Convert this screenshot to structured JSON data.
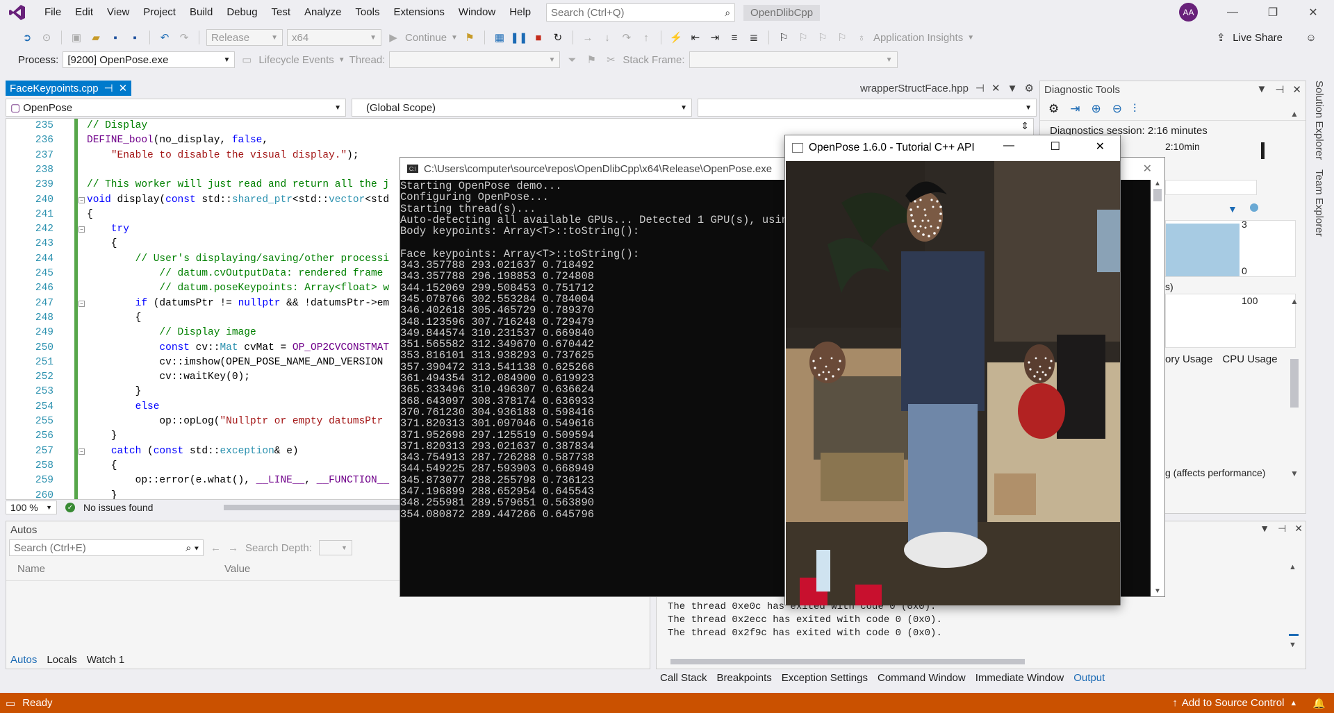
{
  "menubar": {
    "items": [
      "File",
      "Edit",
      "View",
      "Project",
      "Build",
      "Debug",
      "Test",
      "Analyze",
      "Tools",
      "Extensions",
      "Window",
      "Help"
    ],
    "search_placeholder": "Search (Ctrl+Q)",
    "project_name": "OpenDlibCpp",
    "user_initials": "AA"
  },
  "toolbar": {
    "config": "Release",
    "platform": "x64",
    "continue_label": "Continue",
    "app_insights": "Application Insights",
    "live_share": "Live Share"
  },
  "debug_location": {
    "process_label": "Process:",
    "process_value": "[9200] OpenPose.exe",
    "lifecycle_label": "Lifecycle Events",
    "thread_label": "Thread:",
    "stack_frame_label": "Stack Frame:"
  },
  "tabs": {
    "active": "FaceKeypoints.cpp",
    "other": "wrapperStructFace.hpp"
  },
  "navbar": {
    "project": "OpenPose",
    "scope": "(Global Scope)"
  },
  "editor": {
    "lines": [
      {
        "num": "235",
        "text": "// Display"
      },
      {
        "num": "236",
        "text": "DEFINE_bool(no_display, false,"
      },
      {
        "num": "237",
        "text": "    \"Enable to disable the visual display.\");"
      },
      {
        "num": "238",
        "text": ""
      },
      {
        "num": "239",
        "text": "// This worker will just read and return all the j"
      },
      {
        "num": "240",
        "text": "void display(const std::shared_ptr<std::vector<std"
      },
      {
        "num": "241",
        "text": "{"
      },
      {
        "num": "242",
        "text": "    try"
      },
      {
        "num": "243",
        "text": "    {"
      },
      {
        "num": "244",
        "text": "        // User's displaying/saving/other processi"
      },
      {
        "num": "245",
        "text": "            // datum.cvOutputData: rendered frame"
      },
      {
        "num": "246",
        "text": "            // datum.poseKeypoints: Array<float> w"
      },
      {
        "num": "247",
        "text": "        if (datumsPtr != nullptr && !datumsPtr->em"
      },
      {
        "num": "248",
        "text": "        {"
      },
      {
        "num": "249",
        "text": "            // Display image"
      },
      {
        "num": "250",
        "text": "            const cv::Mat cvMat = OP_OP2CVCONSTMAT"
      },
      {
        "num": "251",
        "text": "            cv::imshow(OPEN_POSE_NAME_AND_VERSION"
      },
      {
        "num": "252",
        "text": "            cv::waitKey(0);"
      },
      {
        "num": "253",
        "text": "        }"
      },
      {
        "num": "254",
        "text": "        else"
      },
      {
        "num": "255",
        "text": "            op::opLog(\"Nullptr or empty datumsPtr"
      },
      {
        "num": "256",
        "text": "    }"
      },
      {
        "num": "257",
        "text": "    catch (const std::exception& e)"
      },
      {
        "num": "258",
        "text": "    {"
      },
      {
        "num": "259",
        "text": "        op::error(e.what(), __LINE__, __FUNCTION__"
      },
      {
        "num": "260",
        "text": "    }"
      }
    ],
    "zoom": "100 %",
    "issues": "No issues found"
  },
  "diagnostics": {
    "title": "Diagnostic Tools",
    "session": "Diagnostics session: 2:16 minutes",
    "time_mark": "2:10min",
    "y_top": "3",
    "y_bottom": "0",
    "y_mem": "100",
    "s_label": "s)",
    "tab_memory": "ory Usage",
    "tab_cpu": "CPU Usage",
    "profiling_note": "g (affects performance)"
  },
  "side_tabs": [
    "Solution Explorer",
    "Team Explorer"
  ],
  "autos": {
    "title": "Autos",
    "search_placeholder": "Search (Ctrl+E)",
    "search_depth": "Search Depth:",
    "col_name": "Name",
    "col_value": "Value",
    "tabs": [
      "Autos",
      "Locals",
      "Watch 1"
    ]
  },
  "output": {
    "lines": [
      "The thread 0xe0c has exited with code 0 (0x0).",
      "The thread 0x2ecc has exited with code 0 (0x0).",
      "The thread 0x2f9c has exited with code 0 (0x0)."
    ],
    "tabs": [
      "Call Stack",
      "Breakpoints",
      "Exception Settings",
      "Command Window",
      "Immediate Window",
      "Output"
    ]
  },
  "statusbar": {
    "ready": "Ready",
    "source_control": "Add to Source Control"
  },
  "console": {
    "title": "C:\\Users\\computer\\source\\repos\\OpenDlibCpp\\x64\\Release\\OpenPose.exe",
    "lines": [
      "Starting OpenPose demo...",
      "Configuring OpenPose...",
      "Starting thread(s)...",
      "Auto-detecting all available GPUs... Detected 1 GPU(s), using",
      "Body keypoints: Array<T>::toString():",
      "",
      "Face keypoints: Array<T>::toString():",
      "343.357788 293.021637 0.718492",
      "343.357788 296.198853 0.724808",
      "344.152069 299.508453 0.751712",
      "345.078766 302.553284 0.784004",
      "346.402618 305.465729 0.789370",
      "348.123596 307.716248 0.729479",
      "349.844574 310.231537 0.669840",
      "351.565582 312.349670 0.670442",
      "353.816101 313.938293 0.737625",
      "357.390472 313.541138 0.625266",
      "361.494354 312.084900 0.619923",
      "365.333496 310.496307 0.636624",
      "368.643097 308.378174 0.636933",
      "370.761230 304.936188 0.598416",
      "371.820313 301.097046 0.549616",
      "371.952698 297.125519 0.509594",
      "371.820313 293.021637 0.387834",
      "343.754913 287.726288 0.587738",
      "344.549225 287.593903 0.668949",
      "345.873077 288.255798 0.736123",
      "347.196899 288.652954 0.645543",
      "348.255981 289.579651 0.563890",
      "354.080872 289.447266 0.645796"
    ]
  },
  "openpose_window": {
    "title": "OpenPose 1.6.0 - Tutorial C++ API"
  }
}
